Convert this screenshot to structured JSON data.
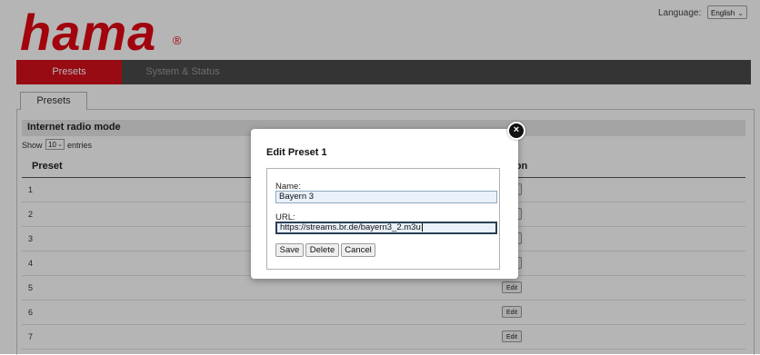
{
  "brand": {
    "logo_text": "hama",
    "registered_mark": "®",
    "accent": "#e30613"
  },
  "language": {
    "label": "Language:",
    "selected": "English"
  },
  "nav": {
    "items": [
      {
        "label": "Presets",
        "active": true
      },
      {
        "label": "System & Status",
        "active": false
      }
    ]
  },
  "tab": {
    "label": "Presets"
  },
  "section": {
    "title": "Internet radio mode"
  },
  "table_controls": {
    "show_label": "Show",
    "entries_value": "10",
    "entries_label": "entries"
  },
  "table": {
    "columns": [
      "Preset",
      "Action"
    ],
    "rows": [
      {
        "preset": "1",
        "action": "Edit"
      },
      {
        "preset": "2",
        "action": "Edit"
      },
      {
        "preset": "3",
        "action": "Edit"
      },
      {
        "preset": "4",
        "action": "Edit"
      },
      {
        "preset": "5",
        "action": "Edit"
      },
      {
        "preset": "6",
        "action": "Edit"
      },
      {
        "preset": "7",
        "action": "Edit"
      }
    ]
  },
  "modal": {
    "title": "Edit Preset 1",
    "name_label": "Name:",
    "name_value": "Bayern 3",
    "url_label": "URL:",
    "url_value": "https://streams.br.de/bayern3_2.m3u",
    "buttons": {
      "save": "Save",
      "delete": "Delete",
      "cancel": "Cancel"
    },
    "close_icon": "×"
  },
  "icons": {
    "dropdown": "chevron-down-icon",
    "close": "close-icon"
  }
}
